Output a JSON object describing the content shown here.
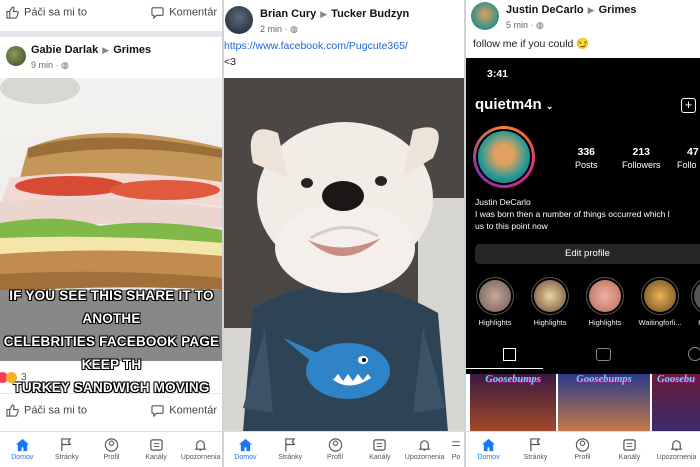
{
  "panel1": {
    "top_actions": {
      "like": "Páči sa mi to",
      "comment": "Komentár"
    },
    "post": {
      "author": "Gabie Darlak",
      "group": "Grimes",
      "time": "9 min",
      "meme_lines": [
        "IF YOU SEE THIS SHARE IT TO ANOTHE",
        "CELEBRITIES FACEBOOK PAGE KEEP TH",
        "TURKEY SANDWICH MOVING"
      ],
      "reaction_count": "3"
    },
    "bottom_actions": {
      "like": "Páči sa mi to",
      "comment": "Komentár"
    },
    "nav": [
      "Domov",
      "Stránky",
      "Profil",
      "Kanály",
      "Upozornenia"
    ]
  },
  "panel2": {
    "post": {
      "author": "Brian Cury",
      "group": "Tucker Budzyn",
      "time": "2 min",
      "link": "https://www.facebook.com/Pugcute365/",
      "text": "<3"
    },
    "nav": [
      "Domov",
      "Stránky",
      "Profil",
      "Kanály",
      "Upozornenia",
      "Po"
    ]
  },
  "panel3": {
    "post": {
      "author": "Justin DeCarlo",
      "group": "Grimes",
      "time": "5 min",
      "text": "follow me if you could 😏"
    },
    "instagram": {
      "clock": "3:41",
      "username": "quietm4n",
      "posts_count": "336",
      "posts_label": "Posts",
      "followers_count": "213",
      "followers_label": "Followers",
      "following_count": "47",
      "following_label": "Follo",
      "display_name": "Justin DeCarlo",
      "bio_line1": "I was born then a number of things occurred which l",
      "bio_line2": "us to this point now",
      "edit_button": "Edit profile",
      "highlights": [
        "Highlights",
        "Highlights",
        "Highlights",
        "Waitingforli...",
        "H"
      ],
      "grid_titles": [
        "Goosebumps",
        "Goosebumps",
        "Goosebu"
      ]
    },
    "nav": [
      "Domov",
      "Stránky",
      "Profil",
      "Kanály",
      "Upozornenia"
    ]
  }
}
